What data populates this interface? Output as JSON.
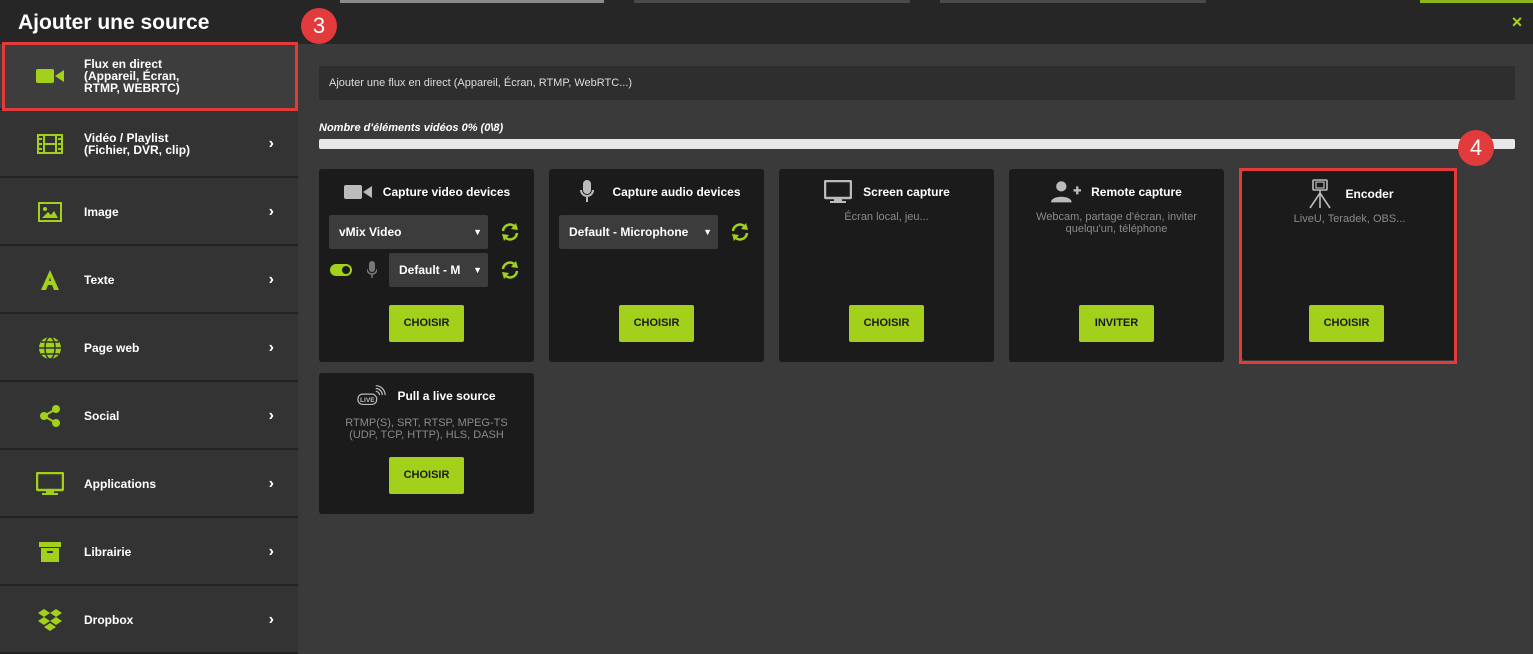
{
  "header": {
    "title": "Ajouter une source",
    "close_label": "×",
    "badge_3": "3",
    "badge_4": "4"
  },
  "sidebar": {
    "items": [
      {
        "label": "Flux en direct\n(Appareil, Écran,\nRTMP, WEBRTC)",
        "icon": "video-camera-icon",
        "chevron": ""
      },
      {
        "label": "Vidéo / Playlist\n(Fichier, DVR, clip)",
        "icon": "film-icon",
        "chevron": "›"
      },
      {
        "label": "Image",
        "icon": "image-icon",
        "chevron": "›"
      },
      {
        "label": "Texte",
        "icon": "text-a-icon",
        "chevron": "›"
      },
      {
        "label": "Page web",
        "icon": "globe-icon",
        "chevron": "›"
      },
      {
        "label": "Social",
        "icon": "share-icon",
        "chevron": "›"
      },
      {
        "label": "Applications",
        "icon": "monitor-icon",
        "chevron": "›"
      },
      {
        "label": "Librairie",
        "icon": "archive-icon",
        "chevron": "›"
      },
      {
        "label": "Dropbox",
        "icon": "dropbox-icon",
        "chevron": "›"
      }
    ]
  },
  "main": {
    "search_text": "Ajouter une flux en direct (Appareil, Écran, RTMP, WebRTC...)",
    "items_label": "Nombre d'éléments vidéos 0% (0\\8)",
    "progress_percent": 0,
    "cards": {
      "video_devices": {
        "title": "Capture video devices",
        "select_value": "vMix Video",
        "audio_select_value": "Default - M",
        "button": "CHOISIR"
      },
      "audio_devices": {
        "title": "Capture audio devices",
        "select_value": "Default - Microphone",
        "button": "CHOISIR"
      },
      "screen": {
        "title": "Screen capture",
        "subtitle": "Écran local, jeu...",
        "button": "CHOISIR"
      },
      "remote": {
        "title": "Remote capture",
        "subtitle": "Webcam, partage d'écran, inviter\nquelqu'un, téléphone",
        "button": "INVITER"
      },
      "encoder": {
        "title": "Encoder",
        "subtitle": "LiveU, Teradek, OBS...",
        "button": "CHOISIR"
      },
      "pull": {
        "title": "Pull a live source",
        "subtitle": "RTMP(S), SRT, RTSP, MPEG-TS\n(UDP, TCP, HTTP), HLS, DASH",
        "button": "CHOISIR"
      }
    }
  },
  "colors": {
    "accent": "#a3d11b",
    "highlight": "#e23b3b"
  }
}
